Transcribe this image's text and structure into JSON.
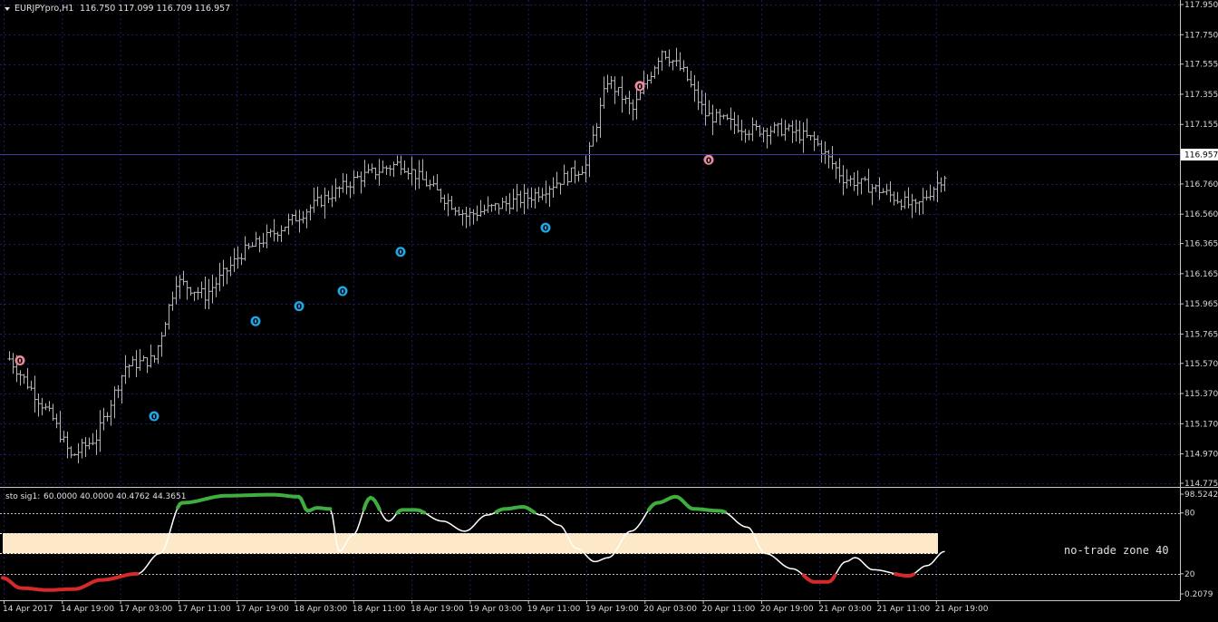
{
  "chart_header": {
    "symbol": "EURJPYpro,H1",
    "ohlc": "116.750 117.099 116.709 116.957"
  },
  "indicator_header": {
    "name": "sto sig1:",
    "values": "60.0000 40.0000 40.4762 44.3651"
  },
  "no_trade_zone_label": "no-trade zone 40",
  "colors": {
    "background": "#000000",
    "grid": "#1c1c6e",
    "bars": "#b4b4b4",
    "axis": "#c8c8c8",
    "buy_signal": "#1fa7e6",
    "sell_signal": "#e98b9b",
    "stoch_line": "#ffffff",
    "stoch_up": "#3fae3f",
    "stoch_down": "#d42a2a",
    "zone_fill": "#fde8c8"
  },
  "chart_data": [
    {
      "type": "ohlc",
      "symbol": "EURJPY",
      "timeframe": "H1",
      "y_ticks": [
        "117.950",
        "117.750",
        "117.555",
        "117.355",
        "117.155",
        "116.760",
        "116.560",
        "116.365",
        "116.165",
        "115.965",
        "115.765",
        "115.570",
        "115.370",
        "115.170",
        "114.970",
        "114.775"
      ],
      "current_price": "116.957",
      "ylim": [
        114.775,
        117.95
      ],
      "x_ticks": [
        "14 Apr 2017",
        "14 Apr 19:00",
        "17 Apr 03:00",
        "17 Apr 11:00",
        "17 Apr 19:00",
        "18 Apr 03:00",
        "18 Apr 11:00",
        "18 Apr 19:00",
        "19 Apr 03:00",
        "19 Apr 11:00",
        "19 Apr 19:00",
        "20 Apr 03:00",
        "20 Apr 11:00",
        "20 Apr 19:00",
        "21 Apr 03:00",
        "21 Apr 11:00",
        "21 Apr 19:00"
      ],
      "bar_count": 114,
      "close_path_anchors": [
        [
          0,
          115.6
        ],
        [
          6,
          115.4
        ],
        [
          12,
          115.2
        ],
        [
          17,
          114.95
        ],
        [
          24,
          115.08
        ],
        [
          32,
          115.55
        ],
        [
          40,
          115.6
        ],
        [
          46,
          116.12
        ],
        [
          54,
          116.02
        ],
        [
          64,
          116.3
        ],
        [
          72,
          116.42
        ],
        [
          84,
          116.62
        ],
        [
          96,
          116.8
        ],
        [
          108,
          116.9
        ],
        [
          126,
          116.55
        ],
        [
          144,
          116.68
        ],
        [
          159,
          116.88
        ],
        [
          165,
          117.45
        ],
        [
          172,
          117.25
        ],
        [
          180,
          117.65
        ],
        [
          186,
          117.5
        ],
        [
          192,
          117.22
        ],
        [
          204,
          117.12
        ],
        [
          214,
          117.12
        ],
        [
          222,
          117.05
        ],
        [
          230,
          116.8
        ],
        [
          240,
          116.72
        ],
        [
          250,
          116.6
        ],
        [
          258,
          116.82
        ]
      ],
      "buy_signals": [
        {
          "bar": 40,
          "price": 115.22
        },
        {
          "bar": 68,
          "price": 115.85
        },
        {
          "bar": 80,
          "price": 115.95
        },
        {
          "bar": 92,
          "price": 116.05
        },
        {
          "bar": 108,
          "price": 116.31
        },
        {
          "bar": 148,
          "price": 116.47
        }
      ],
      "sell_signals": [
        {
          "bar": 3,
          "price": 115.59
        },
        {
          "bar": 174,
          "price": 117.41
        },
        {
          "bar": 193,
          "price": 116.92
        }
      ],
      "signal_marker": "0"
    },
    {
      "type": "line",
      "name": "sto sig1",
      "ylim": [
        0.2079,
        98.5242
      ],
      "y_ticks": [
        "98.5242",
        "80",
        "20",
        "0.2079"
      ],
      "levels": [
        80,
        20
      ],
      "zone": [
        40,
        60
      ],
      "anchors": [
        [
          0,
          16
        ],
        [
          4,
          6
        ],
        [
          10,
          4
        ],
        [
          16,
          5
        ],
        [
          22,
          14
        ],
        [
          30,
          20
        ],
        [
          35,
          40
        ],
        [
          40,
          90
        ],
        [
          50,
          97
        ],
        [
          60,
          98
        ],
        [
          66,
          96
        ],
        [
          68,
          82
        ],
        [
          70,
          85
        ],
        [
          73,
          84
        ],
        [
          75,
          42
        ],
        [
          78,
          58
        ],
        [
          82,
          95
        ],
        [
          86,
          72
        ],
        [
          89,
          83
        ],
        [
          92,
          83
        ],
        [
          98,
          72
        ],
        [
          103,
          62
        ],
        [
          108,
          78
        ],
        [
          112,
          84
        ],
        [
          116,
          86
        ],
        [
          120,
          78
        ],
        [
          124,
          68
        ],
        [
          128,
          45
        ],
        [
          132,
          32
        ],
        [
          135,
          36
        ],
        [
          140,
          62
        ],
        [
          146,
          90
        ],
        [
          150,
          96
        ],
        [
          154,
          84
        ],
        [
          160,
          82
        ],
        [
          166,
          66
        ],
        [
          170,
          40
        ],
        [
          176,
          25
        ],
        [
          181,
          12
        ],
        [
          184,
          12
        ],
        [
          188,
          32
        ],
        [
          190,
          36
        ],
        [
          194,
          24
        ],
        [
          202,
          18
        ],
        [
          206,
          28
        ],
        [
          210,
          42
        ]
      ]
    }
  ]
}
